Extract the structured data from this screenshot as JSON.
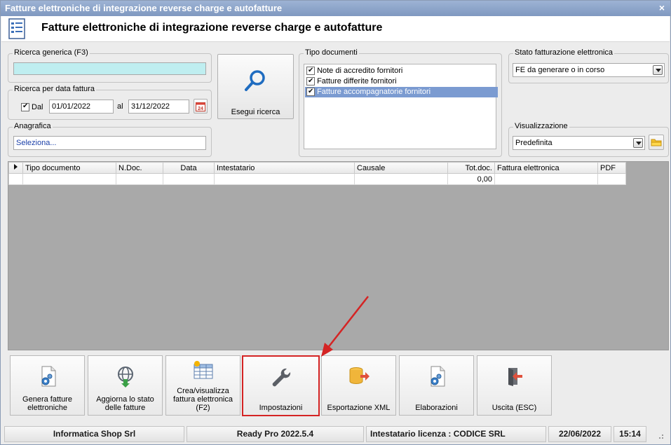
{
  "window": {
    "title": "Fatture elettroniche di integrazione reverse charge e autofatture",
    "close_glyph": "×"
  },
  "header": {
    "title": "Fatture elettroniche di integrazione reverse charge e autofatture",
    "icon": "document-list-icon"
  },
  "search": {
    "generic_label": "Ricerca generica (F3)",
    "generic_value": "",
    "date_group_label": "Ricerca per data fattura",
    "dal_label": "Dal",
    "dal_checked": true,
    "date_from": "01/01/2022",
    "al_label": "al",
    "date_to": "31/12/2022",
    "anagrafica_label": "Anagrafica",
    "anagrafica_value": "Seleziona...",
    "search_button_label": "Esegui ricerca"
  },
  "tipo_documenti": {
    "label": "Tipo documenti",
    "items": [
      {
        "label": "Note di accredito fornitori",
        "checked": true,
        "selected": false
      },
      {
        "label": "Fatture differite fornitori",
        "checked": true,
        "selected": false
      },
      {
        "label": "Fatture accompagnatorie fornitori",
        "checked": true,
        "selected": true
      }
    ]
  },
  "stato": {
    "label": "Stato fatturazione elettronica",
    "value": "FE da generare o in corso"
  },
  "visualizzazione": {
    "label": "Visualizzazione",
    "value": "Predefinita"
  },
  "grid": {
    "columns": [
      "Tipo documento",
      "N.Doc.",
      "Data",
      "Intestatario",
      "Causale",
      "Tot.doc.",
      "Fattura elettronica",
      "PDF"
    ],
    "rows": [
      [
        "",
        "",
        "",
        "",
        "",
        "0,00",
        "",
        ""
      ]
    ]
  },
  "actions": [
    {
      "name": "genera-fatture-button",
      "label": "Genera fatture elettroniche",
      "icon": "gear-document-icon"
    },
    {
      "name": "aggiorna-stato-button",
      "label": "Aggiorna lo stato delle fatture",
      "icon": "globe-download-icon"
    },
    {
      "name": "crea-visualizza-button",
      "label": "Crea/visualizza fattura elettronica (F2)",
      "icon": "table-sun-icon"
    },
    {
      "name": "impostazioni-button",
      "label": "Impostazioni",
      "icon": "wrench-icon"
    },
    {
      "name": "esportazione-xml-button",
      "label": "Esportazione XML",
      "icon": "database-export-icon"
    },
    {
      "name": "elaborazioni-button",
      "label": "Elaborazioni",
      "icon": "gear-document-icon"
    },
    {
      "name": "uscita-button",
      "label": "Uscita (ESC)",
      "icon": "exit-door-icon"
    }
  ],
  "statusbar": {
    "company": "Informatica Shop Srl",
    "version": "Ready Pro 2022.5.4",
    "license": "Intestatario licenza : CODICE SRL",
    "date": "22/06/2022",
    "time": "15:14"
  },
  "colors": {
    "title_bar": "#8ea6cb",
    "highlight": "#d42424",
    "arrow": "#d42424",
    "selection": "#7b9bd1",
    "search_field": "#bfeef0"
  }
}
